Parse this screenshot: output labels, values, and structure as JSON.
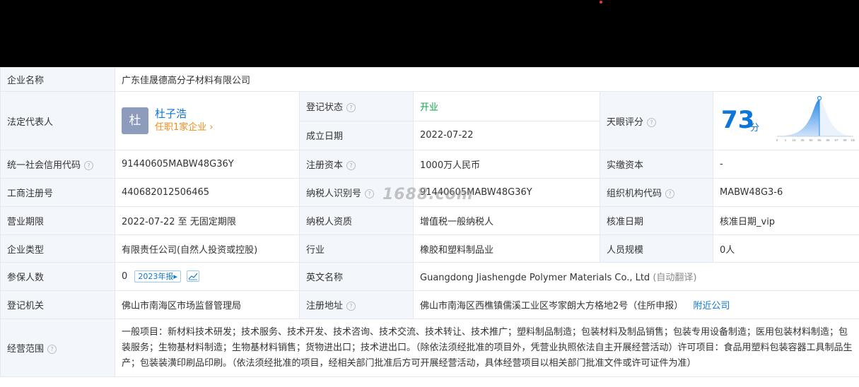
{
  "company_name_label": "企业名称",
  "company_name": "广东佳晟德高分子材料有限公司",
  "legal_rep": {
    "label": "法定代表人",
    "avatar_char": "杜",
    "name": "杜子浩",
    "sub": "任职1家企业 ›"
  },
  "reg_status": {
    "label": "登记状态",
    "value": "开业"
  },
  "est_date": {
    "label": "成立日期",
    "value": "2022-07-22"
  },
  "score": {
    "label": "天眼评分",
    "value": "73",
    "unit": "分",
    "axis_ticks": [
      "0",
      "1",
      "15",
      "35",
      "50",
      "65",
      "85",
      "97",
      "99",
      "100"
    ]
  },
  "credit_code": {
    "label": "统一社会信用代码",
    "value": "91440605MABW48G36Y"
  },
  "reg_capital": {
    "label": "注册资本",
    "value": "1000万人民币"
  },
  "paid_capital": {
    "label": "实缴资本",
    "value": "-"
  },
  "business_reg_no": {
    "label": "工商注册号",
    "value": "440682012506465"
  },
  "taxpayer_id": {
    "label": "纳税人识别号",
    "value": "91440605MABW48G36Y"
  },
  "org_code": {
    "label": "组织机构代码",
    "value": "MABW48G3-6"
  },
  "term": {
    "label": "营业期限",
    "value": "2022-07-22 至 无固定期限"
  },
  "taxpayer_qual": {
    "label": "纳税人资质",
    "value": "增值税一般纳税人"
  },
  "approval_date": {
    "label": "核准日期",
    "value": "核准日期_vip"
  },
  "company_type": {
    "label": "企业类型",
    "value": "有限责任公司(自然人投资或控股)"
  },
  "industry": {
    "label": "行业",
    "value": "橡胶和塑料制品业"
  },
  "staff_size": {
    "label": "人员规模",
    "value": "0人"
  },
  "insured": {
    "label": "参保人数",
    "value": "0",
    "report_badge": "2023年报▸"
  },
  "english_name": {
    "label": "英文名称",
    "value": "Guangdong Jiashengde Polymer Materials Co., Ltd",
    "note": "(自动翻译)"
  },
  "reg_authority": {
    "label": "登记机关",
    "value": "佛山市南海区市场监督管理局"
  },
  "reg_address": {
    "label": "注册地址",
    "value": "佛山市南海区西樵镇儒溪工业区岑家朗大方格地2号（住所申报）",
    "link": "附近公司"
  },
  "scope": {
    "label": "经营范围",
    "value": "一般项目：新材料技术研发；技术服务、技术开发、技术咨询、技术交流、技术转让、技术推广；塑料制品制造；包装材料及制品销售；包装专用设备制造；医用包装材料制造；包装服务；生物基材料制造；生物基材料销售；货物进出口；技术进出口。（除依法须经批准的项目外，凭营业执照依法自主开展经营活动）许可项目：食品用塑料包装容器工具制品生产；包装装潢印刷品印刷。（依法须经批准的项目，经相关部门批准后方可开展经营活动，具体经营项目以相关部门批准文件或许可证件为准）"
  },
  "watermark": "1688.com",
  "colors": {
    "link": "#0e76d8",
    "status_green": "#12a44a",
    "label_bg": "#f3f7fc",
    "sub_orange": "#f28b1a"
  }
}
